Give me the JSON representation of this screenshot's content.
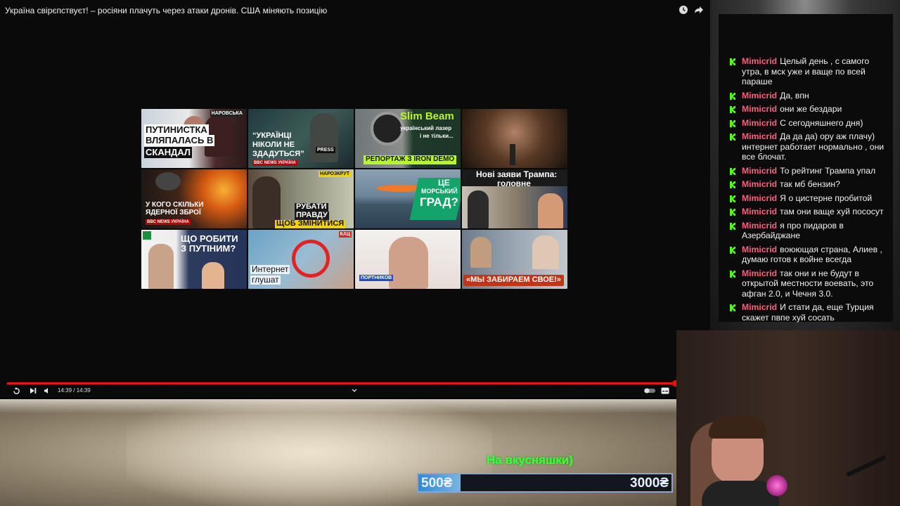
{
  "video": {
    "title": "Україна свірєпствуєт! – росіяни плачуть через атаки дронів. США міняють позицію",
    "time": "14:39 / 14:39",
    "progress": 1.0
  },
  "thumbnails": [
    {
      "lines": [
        "ПУТИНИСТКА",
        "ВЛЯПАЛАСЬ В",
        "СКАНДАЛ"
      ],
      "tag": "НАРОВСЬКА"
    },
    {
      "lines": [
        "“УКРАЇНЦІ",
        "НІКОЛИ НЕ",
        "ЗДАДУТЬСЯ”"
      ],
      "brand": "BBC NEWS УКРАЇНА",
      "extra": "PRESS"
    },
    {
      "title": "Slim Beam",
      "sub": [
        "український лазер",
        "і не тільки..."
      ],
      "banner": "РЕПОРТАЖ З IRON DEMO"
    },
    {},
    {
      "lines": [
        "У КОГО СКІЛЬКИ",
        "ЯДЕРНОЇ ЗБРОЇ"
      ],
      "brand": "BBC NEWS УКРАЇНА"
    },
    {
      "lines": [
        "РУБАТИ",
        "ПРАВДУ"
      ],
      "banner": "ЩОБ ЗМІНИТИСЯ",
      "tag": "НАРОЗКРУТ"
    },
    {
      "lines": [
        "ЦЕ",
        "МОРСЬКИЙ",
        "ГРАД?"
      ]
    },
    {
      "lines": [
        "Нові заяви Трампа:",
        "головне"
      ]
    },
    {
      "lines": [
        "ЩО РОБИТИ",
        "З ПУТІНИМ?"
      ]
    },
    {
      "lines": [
        "Интернет",
        "глушат"
      ],
      "tag": "КАЦ"
    },
    {
      "tag": "ПОРТНИКОВ"
    },
    {
      "banner": "«МЫ ЗАБИРАЕМ СВОЕ!»"
    }
  ],
  "chat": {
    "messages": [
      {
        "user": "Mimicrid",
        "text": "Целый день , с самого утра, в мск уже и ваще по всей параше"
      },
      {
        "user": "Mimicrid",
        "text": "Да, впн"
      },
      {
        "user": "Mimicrid",
        "text": "они же бездари"
      },
      {
        "user": "Mimicrid",
        "text": "С сегодняшнего дня)"
      },
      {
        "user": "Mimicrid",
        "text": "Да да да) ору аж плачу) интернет работает нормально , они все блочат."
      },
      {
        "user": "Mimicrid",
        "text": "То рейтинг Трампа упал"
      },
      {
        "user": "Mimicrid",
        "text": "так мб бензин?"
      },
      {
        "user": "Mimicrid",
        "text": "Я о цистерне пробитой"
      },
      {
        "user": "Mimicrid",
        "text": "там они ваще хуй пососут"
      },
      {
        "user": "Mimicrid",
        "text": "я про пидаров в Азербайджане"
      },
      {
        "user": "Mimicrid",
        "text": "воюющая страна, Алиев , думаю готов к войне всегда"
      },
      {
        "user": "Mimicrid",
        "text": "так они и не будут в открытой местности воевать, это афган 2.0, и Чечня 3.0."
      },
      {
        "user": "Mimicrid",
        "text": "И стати да, еще Турция скажет пвпе хуй сосать"
      }
    ]
  },
  "donation": {
    "title": "На вкусняшки)",
    "current": "500₴",
    "goal": "3000₴",
    "fraction": 0.167
  },
  "colors": {
    "accent": "#e11d1d",
    "username": "#ff5f7e",
    "kick_green": "#53fc18",
    "donation_green": "#3dff3d"
  }
}
